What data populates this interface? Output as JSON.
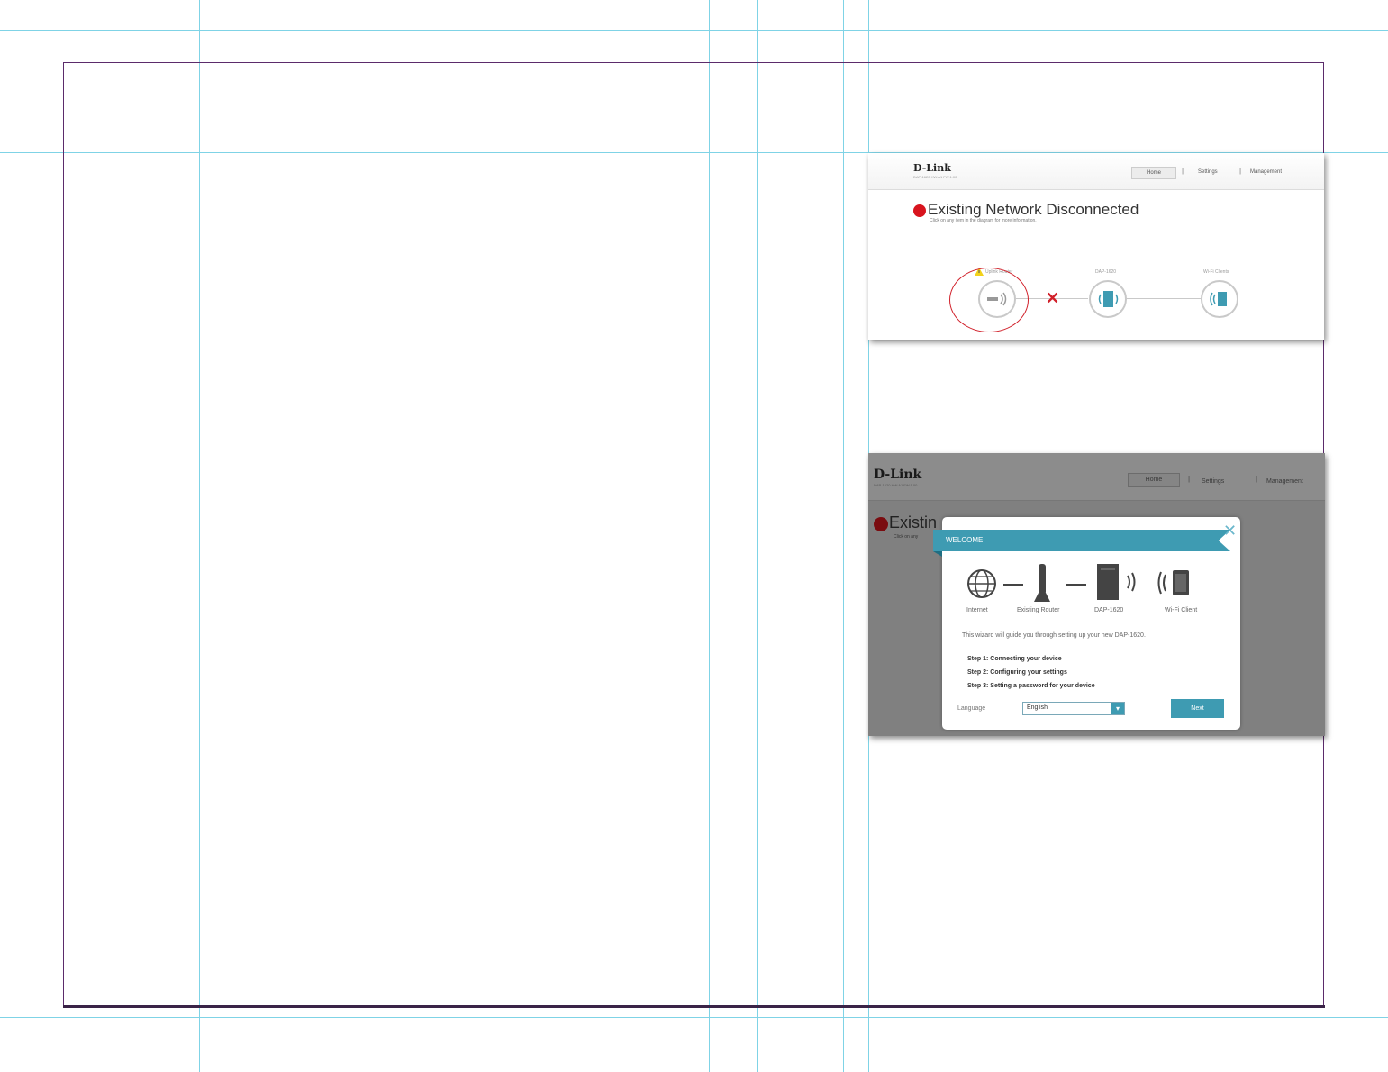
{
  "screenshot_1": {
    "brand": "D-Link",
    "brand_sub": "DAP-1620 HW:A1 FW:1.00",
    "nav": [
      "Home",
      "Settings",
      "Management"
    ],
    "title": "Existing Network Disconnected",
    "subtitle": "Click on any item in the diagram for more information.",
    "nodes": [
      "Uplink Router",
      "DAP-1620",
      "Wi-Fi Clients"
    ],
    "status_color": "#d8141e",
    "warning_icon": "warning-icon"
  },
  "screenshot_2": {
    "brand": "D-Link",
    "brand_sub": "DAP-1620 HW:A1 FW:1.00",
    "nav": [
      "Home",
      "Settings",
      "Management"
    ],
    "background_title": "Existin",
    "background_subtitle": "Click on any",
    "modal": {
      "ribbon": "WELCOME",
      "devices": [
        "Internet",
        "Existing Router",
        "DAP-1620",
        "Wi-Fi Client"
      ],
      "intro": "This wizard will guide you through setting up your new DAP-1620.",
      "steps": [
        "Step 1: Connecting your device",
        "Step 2: Configuring your settings",
        "Step 3: Setting a password for your device"
      ],
      "language_label": "Language",
      "language_value": "English",
      "next_label": "Next",
      "accent_color": "#3e9bb2"
    }
  }
}
